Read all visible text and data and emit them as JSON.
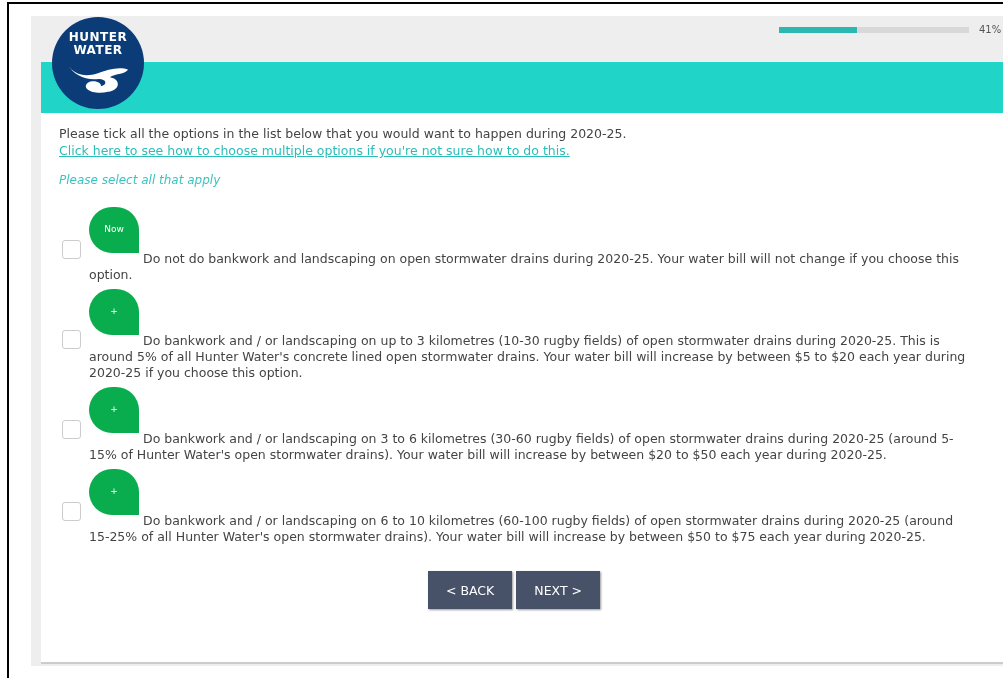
{
  "logo": {
    "lines": [
      "HUNTER",
      "WATER"
    ]
  },
  "progress": {
    "level": 0.41,
    "label": "41%"
  },
  "instruction": {
    "text": "Please tick all the options in the list below that you would want to happen during 2020-25.",
    "link": "Click here to see how to choose multiple options if you're not sure how to do this."
  },
  "hint": "Please select all that apply",
  "options": [
    {
      "badge": "Now",
      "checked": false,
      "text": "Do not do bankwork and landscaping on open stormwater drains during 2020-25. Your water bill will not change if you choose this option."
    },
    {
      "badge": "+",
      "checked": false,
      "text": "Do bankwork and / or landscaping on up to 3 kilometres (10-30 rugby fields) of open stormwater drains during 2020-25. This is around 5% of all Hunter Water's concrete lined open stormwater drains. Your water bill will increase by between $5 to $20 each year during 2020-25 if you choose this option."
    },
    {
      "badge": "+",
      "checked": false,
      "text": "Do bankwork and / or landscaping on 3 to 6 kilometres (30-60 rugby fields) of open stormwater drains during 2020-25 (around 5-15% of Hunter Water's open stormwater drains). Your water bill will increase by between $20 to $50 each year during 2020-25."
    },
    {
      "badge": "+",
      "checked": false,
      "text": "Do bankwork and / or landscaping on 6 to 10 kilometres (60-100 rugby fields) of open stormwater drains during 2020-25 (around 15-25% of all Hunter Water's open stormwater drains). Your water bill will increase by between $50 to $75 each year during 2020-25."
    }
  ],
  "buttons": [
    "< BACK",
    "NEXT >"
  ]
}
